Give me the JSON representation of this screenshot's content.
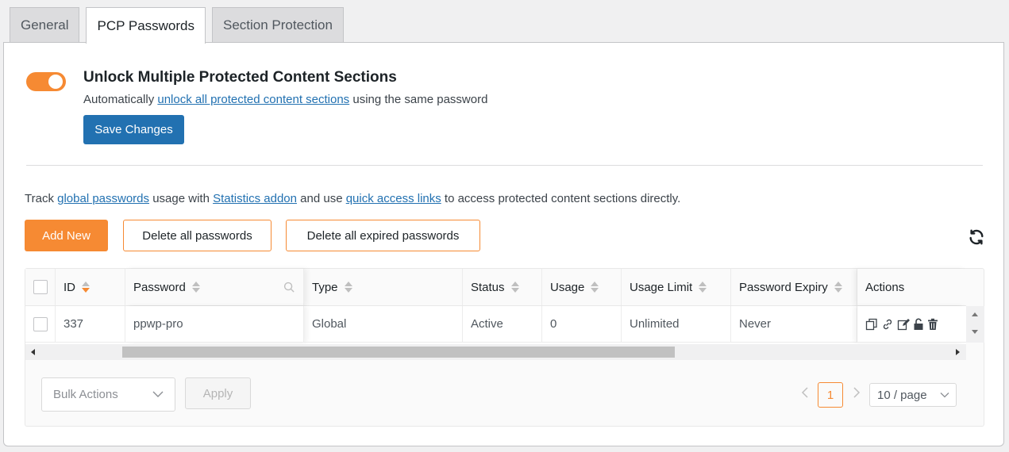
{
  "tabs": [
    {
      "label": "General"
    },
    {
      "label": "PCP Passwords"
    },
    {
      "label": "Section Protection"
    }
  ],
  "option": {
    "enabled": true,
    "title": "Unlock Multiple Protected Content Sections",
    "desc_before": "Automatically ",
    "desc_link": "unlock all protected content sections",
    "desc_after": " using the same password",
    "save_label": "Save Changes"
  },
  "track": {
    "t1": "Track ",
    "l1": "global passwords",
    "t2": " usage with ",
    "l2": "Statistics addon",
    "t3": " and use ",
    "l3": "quick access links",
    "t4": " to access protected content sections directly."
  },
  "toolbar": {
    "add_label": "Add New",
    "delete_all_label": "Delete all passwords",
    "delete_expired_label": "Delete all expired passwords",
    "refresh_icon": "refresh-icon"
  },
  "table": {
    "headers": {
      "id": "ID",
      "password": "Password",
      "type": "Type",
      "status": "Status",
      "usage": "Usage",
      "usage_limit": "Usage Limit",
      "expiry": "Password Expiry",
      "actions": "Actions"
    },
    "rows": [
      {
        "id": "337",
        "password": "ppwp-pro",
        "type": "Global",
        "status": "Active",
        "usage": "0",
        "usage_limit": "Unlimited",
        "expiry": "Never"
      }
    ],
    "action_icons": [
      "copy-icon",
      "link-icon",
      "edit-icon",
      "unlock-icon",
      "trash-icon"
    ],
    "status_color": "#1e8c3a"
  },
  "footer": {
    "bulk_placeholder": "Bulk Actions",
    "apply_label": "Apply",
    "current_page": "1",
    "page_size": "10 / page"
  },
  "colors": {
    "accent": "#f68a33",
    "primary": "#2271b1"
  }
}
